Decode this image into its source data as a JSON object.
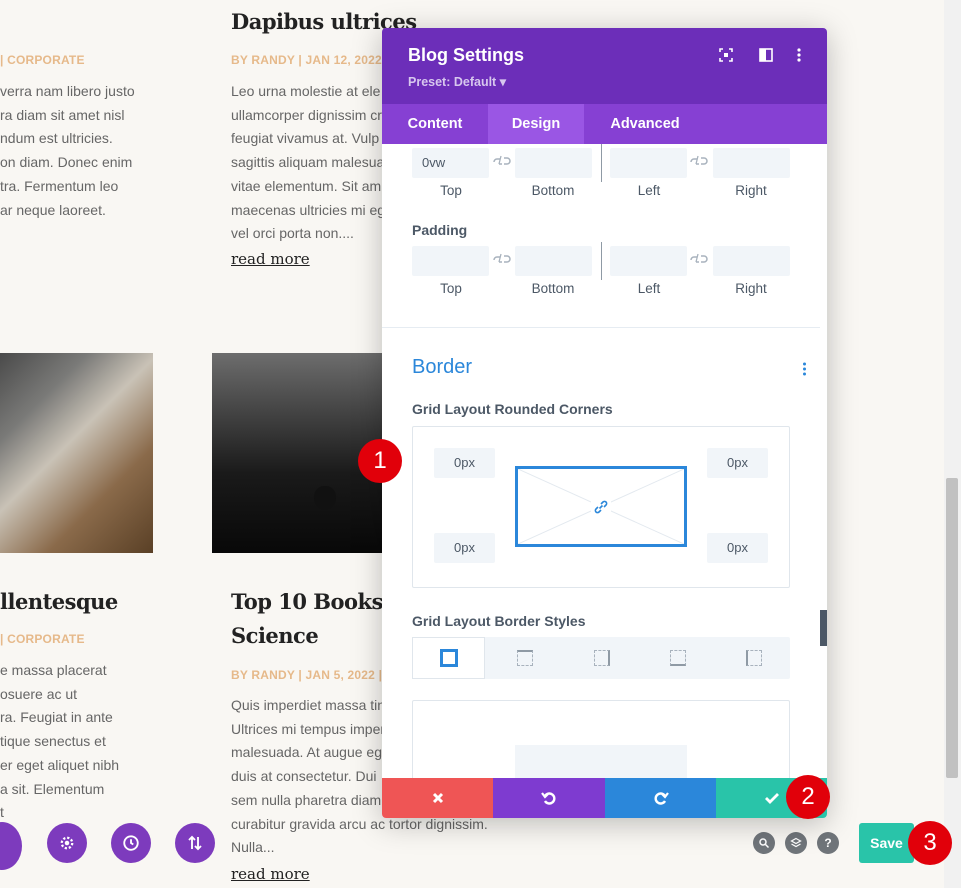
{
  "blog": {
    "left_col": {
      "meta_top": "| CORPORATE",
      "excerpt_top": "verra nam libero justo\nra diam sit amet nisl\nndum est ultricies.\non diam. Donec enim\ntra. Fermentum leo\nar neque laoreet.",
      "title_bottom": "llentesque",
      "meta_bottom": "| CORPORATE",
      "excerpt_bottom": "e massa placerat\nosuere ac ut\nra. Feugiat in ante\ntique senectus et\ner eget aliquet nibh\na sit. Elementum\nt"
    },
    "mid_col": {
      "title_top": "Dapibus ultrices",
      "meta_top": "BY RANDY | JAN 12, 2022 |",
      "excerpt_top": "Leo urna molestie at ele\nullamcorper dignissim cr\nfeugiat vivamus at. Vulp\nsagittis aliquam malesua\nvitae elementum. Sit am\nmaecenas ultricies mi eg\nvel orci porta non....",
      "read_more_top": "read more",
      "title_bottom_line1": "Top 10 Books o",
      "title_bottom_line2": "Science",
      "meta_bottom": "BY RANDY | JAN 5, 2022 |",
      "excerpt_bottom": "Quis imperdiet massa tin\nUltrices mi tempus imper\nmalesuada. At augue eg\nduis at consectetur. Dui\nsem nulla pharetra diam\ncurabitur gravida arcu ac tortor dignissim.\nNulla...",
      "read_more_bottom": "read more"
    }
  },
  "modal": {
    "title": "Blog Settings",
    "preset": "Preset: Default ▾",
    "tabs": [
      "Content",
      "Design",
      "Advanced"
    ],
    "active_tab": "Design",
    "margin": {
      "top_value": "0vw",
      "labels": [
        "Top",
        "Bottom",
        "Left",
        "Right"
      ]
    },
    "padding": {
      "label": "Padding",
      "labels": [
        "Top",
        "Bottom",
        "Left",
        "Right"
      ]
    },
    "border": {
      "heading": "Border",
      "rounded_label": "Grid Layout Rounded Corners",
      "corners": [
        "0px",
        "0px",
        "0px",
        "0px"
      ],
      "styles_label": "Grid Layout Border Styles"
    }
  },
  "badges": [
    "1",
    "2",
    "3"
  ],
  "save_label": "Save",
  "colors": {
    "purple_header": "#6c2eb9",
    "purple_tabs": "#8640d3",
    "cancel_red": "#ef5555",
    "undo_purple": "#7e3bd0",
    "redo_blue": "#2b87da",
    "confirm_teal": "#29c4a9",
    "badge_red": "#e1000a",
    "meta_tan": "#e6b98a",
    "border_blue": "#2b87da"
  },
  "icons": [
    "move-icon",
    "split-view-icon",
    "more-vertical-icon",
    "link-icon",
    "close-icon",
    "undo-icon",
    "redo-icon",
    "check-icon",
    "gear-icon",
    "history-icon",
    "sort-icon",
    "zoom-icon",
    "layers-icon",
    "help-icon"
  ]
}
